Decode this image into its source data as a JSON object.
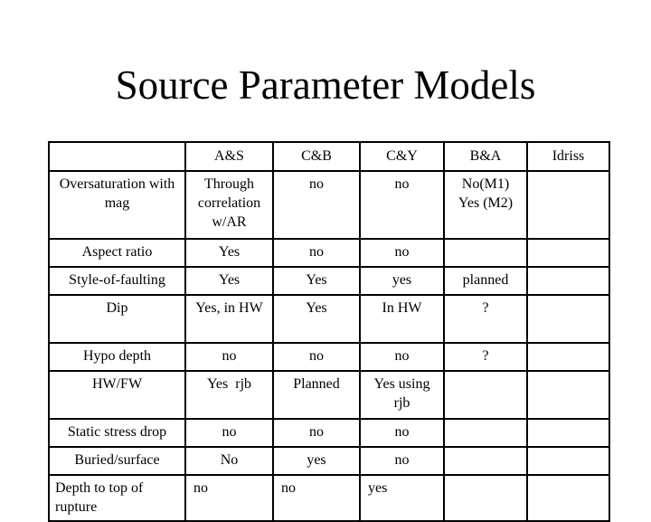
{
  "slide": {
    "title": "Source Parameter Models"
  },
  "table": {
    "columns": [
      "",
      "A&S",
      "C&B",
      "C&Y",
      "B&A",
      "Idriss"
    ],
    "rows": [
      {
        "parameter": "Oversaturation with mag",
        "values": [
          "Through correlation w/AR",
          "no",
          "no",
          "No(M1) Yes (M2)",
          ""
        ]
      },
      {
        "parameter": "Aspect ratio",
        "values": [
          "Yes",
          "no",
          "no",
          "",
          ""
        ]
      },
      {
        "parameter": "Style-of-faulting",
        "values": [
          "Yes",
          "Yes",
          "yes",
          "planned",
          ""
        ]
      },
      {
        "parameter": "Dip",
        "values": [
          "Yes, in HW",
          "Yes",
          "In HW",
          "?",
          ""
        ]
      },
      {
        "parameter": "Hypo depth",
        "values": [
          "no",
          "no",
          "no",
          "?",
          ""
        ]
      },
      {
        "parameter": "HW/FW",
        "values": [
          "Yes  rjb",
          "Planned",
          "Yes using rjb",
          "",
          ""
        ]
      },
      {
        "parameter": "Static stress drop",
        "values": [
          "no",
          "no",
          "no",
          "",
          ""
        ]
      },
      {
        "parameter": "Buried/surface",
        "values": [
          "No",
          "yes",
          "no",
          "",
          ""
        ]
      },
      {
        "parameter": "Depth to top of rupture",
        "values": [
          "no",
          "no",
          "yes",
          "",
          ""
        ]
      }
    ]
  }
}
